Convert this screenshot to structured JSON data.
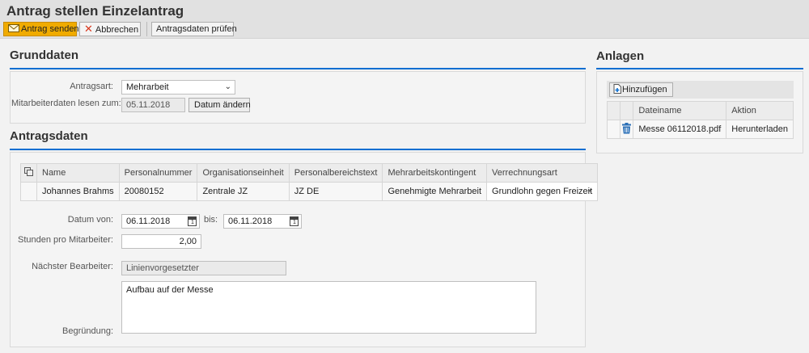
{
  "header": {
    "title": "Antrag stellen Einzelantrag",
    "send_label": "Antrag senden",
    "cancel_label": "Abbrechen",
    "check_label": "Antragsdaten prüfen"
  },
  "grunddaten": {
    "title": "Grunddaten",
    "type_label": "Antragsart:",
    "type_value": "Mehrarbeit",
    "date_label": "Mitarbeiterdaten lesen zum:",
    "date_value": "05.11.2018",
    "change_date_label": "Datum ändern"
  },
  "antragsdaten": {
    "title": "Antragsdaten",
    "columns": [
      "Name",
      "Personalnummer",
      "Organisationseinheit",
      "Personalbereichstext",
      "Mehrarbeitskontingent",
      "Verrechnungsart"
    ],
    "row": {
      "name": "Johannes Brahms",
      "personalnummer": "20080152",
      "org": "Zentrale JZ",
      "bereich": "JZ DE",
      "kontingent": "Genehmigte Mehrarbeit",
      "verrechnung": "Grundlohn gegen Freizeit"
    },
    "date_from_label": "Datum von:",
    "date_from": "06.11.2018",
    "date_to_label": "bis:",
    "date_to": "06.11.2018",
    "hours_label": "Stunden pro Mitarbeiter:",
    "hours_value": "2,00",
    "next_label": "Nächster Bearbeiter:",
    "next_value": "Linienvorgesetzter",
    "reason_label": "Begründung:",
    "reason_value": "Aufbau auf der Messe"
  },
  "anlagen": {
    "title": "Anlagen",
    "add_label": "Hinzufügen",
    "col_filename": "Dateiname",
    "col_action": "Aktion",
    "file_name": "Messe 06112018.pdf",
    "file_action": "Herunterladen"
  },
  "colors": {
    "accent": "#0a6ed1",
    "primary_button": "#f0ab00",
    "delete_icon": "#2a6fb7"
  },
  "icons": [
    "send-icon",
    "cancel-icon",
    "chevron-down-icon",
    "calendar-icon",
    "column-settings-icon",
    "add-attachment-icon",
    "trash-icon"
  ]
}
